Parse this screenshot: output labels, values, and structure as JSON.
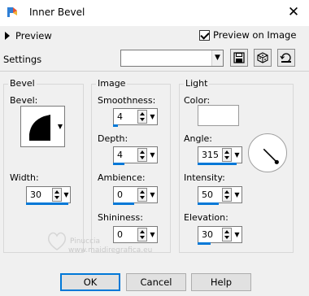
{
  "window": {
    "title": "Inner Bevel",
    "close_glyph": "✕"
  },
  "preview": {
    "label": "Preview",
    "preview_on_image_label": "Preview on Image",
    "preview_on_image_checked": true
  },
  "settings": {
    "label": "Settings",
    "selected_value": "",
    "dropdown_glyph": "⌄"
  },
  "bevel_group": {
    "title": "Bevel",
    "bevel_label": "Bevel:",
    "width_label": "Width:",
    "width_value": "30"
  },
  "image_group": {
    "title": "Image",
    "smoothness_label": "Smoothness:",
    "smoothness_value": "4",
    "depth_label": "Depth:",
    "depth_value": "4",
    "ambience_label": "Ambience:",
    "ambience_value": "0",
    "shininess_label": "Shininess:",
    "shininess_value": "0"
  },
  "light_group": {
    "title": "Light",
    "color_label": "Color:",
    "color_value": "#ffffff",
    "angle_label": "Angle:",
    "angle_value": "315",
    "intensity_label": "Intensity:",
    "intensity_value": "50",
    "elevation_label": "Elevation:",
    "elevation_value": "30"
  },
  "buttons": {
    "ok": "OK",
    "cancel": "Cancel",
    "help": "Help"
  },
  "watermark": {
    "line1": "Pinuccia",
    "line2": "www.maidiregrafica.eu"
  },
  "colors": {
    "accent": "#0078d7",
    "background": "#f0f0f0"
  },
  "icons": [
    "app-icon",
    "close-icon",
    "expand-triangle-icon",
    "save-icon",
    "randomize-icon",
    "reset-icon",
    "bevel-shape-icon",
    "angle-dial-icon"
  ]
}
